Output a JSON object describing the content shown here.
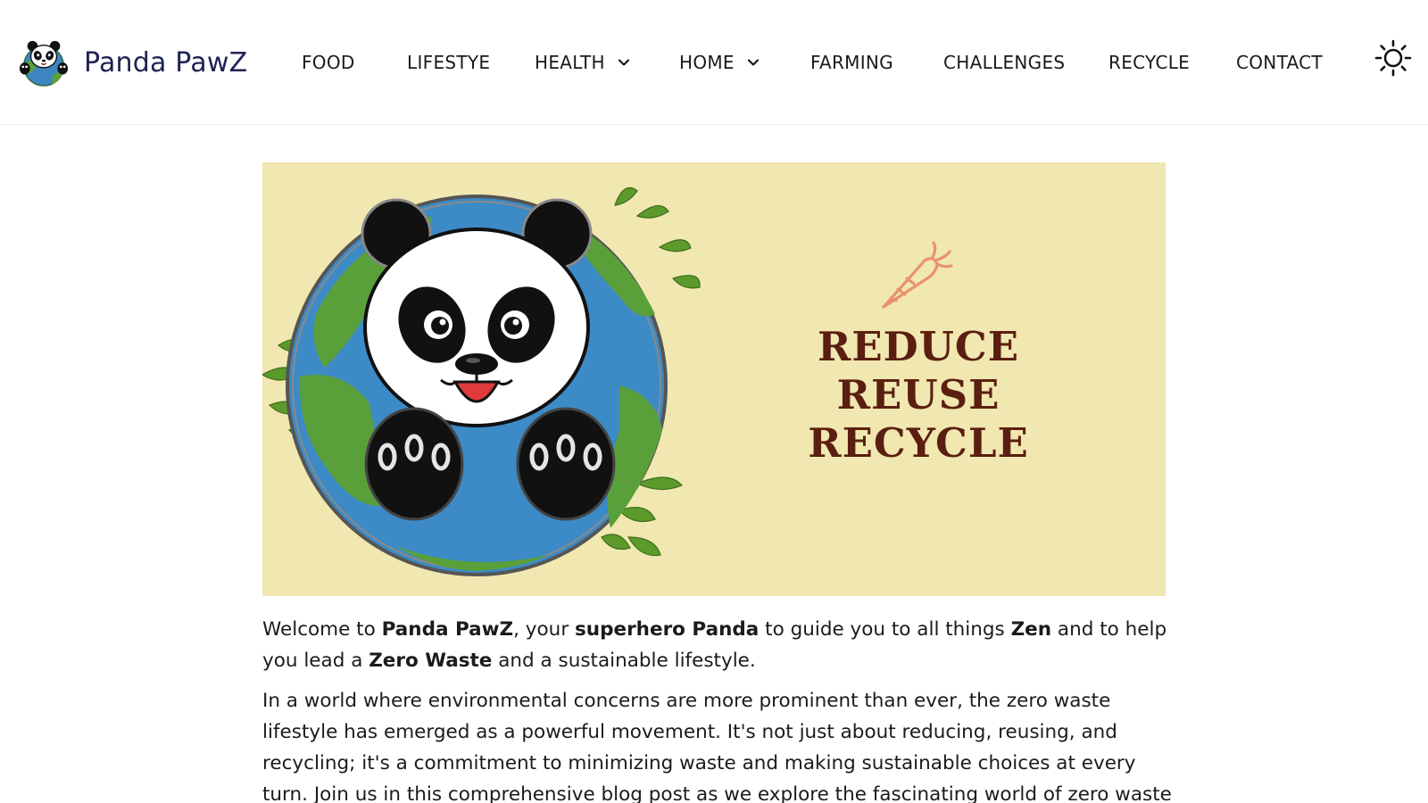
{
  "brand": {
    "name": "Panda PawZ",
    "logo_icon": "panda-globe-logo-icon"
  },
  "nav": {
    "items": [
      {
        "label": "FOOD",
        "has_dropdown": false
      },
      {
        "label": "LIFESTYE",
        "has_dropdown": false
      },
      {
        "label": "HEALTH",
        "has_dropdown": true
      },
      {
        "label": "HOME",
        "has_dropdown": true
      },
      {
        "label": "FARMING",
        "has_dropdown": false
      },
      {
        "label": "CHALLENGES",
        "has_dropdown": false
      },
      {
        "label": "RECYCLE",
        "has_dropdown": false
      },
      {
        "label": "CONTACT",
        "has_dropdown": false
      }
    ],
    "dropdown_icon": "chevron-down-icon",
    "theme_toggle_icon": "sun-icon"
  },
  "hero": {
    "image": "panda-earth-banner",
    "icon": "carrot-icon",
    "slogan": [
      "REDUCE",
      "REUSE",
      "RECYCLE"
    ],
    "colors": {
      "background": "#f1e7b0",
      "slogan": "#5a1f10",
      "carrot": "#e8926d"
    }
  },
  "article": {
    "intro": {
      "t1": "Welcome to ",
      "b1": "Panda PawZ",
      "t2": ", your ",
      "b2": "superhero Panda",
      "t3": " to guide you to all things ",
      "b3": "Zen",
      "t4": " and to help you lead a ",
      "b4": "Zero Waste",
      "t5": " and a sustainable lifestyle."
    },
    "body": "In a world where environmental concerns are more prominent than ever, the zero waste lifestyle has emerged as a powerful movement. It's not just about reducing, reusing, and recycling; it's a commitment to minimizing waste and making sustainable choices at every turn. Join us in this comprehensive blog post as we explore the fascinating world of zero waste living."
  },
  "colors": {
    "brand_text": "#1d2452",
    "nav_text": "#1a1a1a"
  }
}
